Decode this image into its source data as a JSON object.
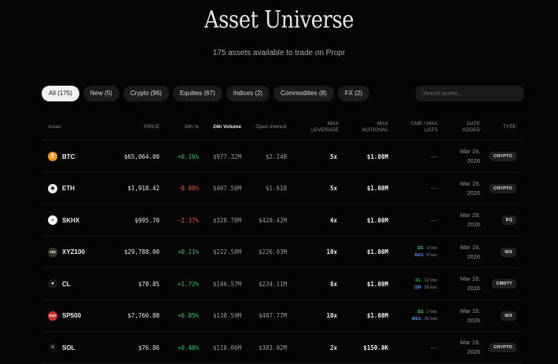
{
  "header": {
    "title": "Asset Universe",
    "subtitle": "175 assets available to trade on Propr"
  },
  "filters": [
    {
      "label": "All (175)",
      "active": true
    },
    {
      "label": "New (5)",
      "active": false
    },
    {
      "label": "Crypto (96)",
      "active": false
    },
    {
      "label": "Equities (67)",
      "active": false
    },
    {
      "label": "Indices (2)",
      "active": false
    },
    {
      "label": "Commodities (8)",
      "active": false
    },
    {
      "label": "FX (2)",
      "active": false
    }
  ],
  "search": {
    "placeholder": "Search assets..."
  },
  "table": {
    "headers": {
      "asset": "Asset",
      "price": "PRICE",
      "change": "24h %",
      "volume": "24h Volume",
      "open_interest": "Open Interest",
      "max_leverage": "MAX LEVERAGE",
      "max_notional": "MAX NOTIONAL",
      "cme_lots": "CME / MAX LOTS",
      "date_added": "DATE ADDED",
      "type": "TYPE"
    },
    "rows": [
      {
        "symbol": "BTC",
        "icon": "bitcoin-icon",
        "icon_glyph": "₿",
        "icon_color": "#f7931a",
        "price": "$65,064.00",
        "change": "+0.16%",
        "dir": "pos",
        "volume": "$977.32M",
        "oi": "$2.24B",
        "leverage": "5x",
        "notional": "$1.00M",
        "lots": [],
        "date_line1": "Mar 19,",
        "date_line2": "2026",
        "type": "CRYPTO"
      },
      {
        "symbol": "ETH",
        "icon": "ethereum-icon",
        "icon_glyph": "◆",
        "icon_color": "#eaeaea",
        "price": "$1,918.42",
        "change": "-0.08%",
        "dir": "neg",
        "volume": "$407.50M",
        "oi": "$1.61B",
        "leverage": "5x",
        "notional": "$1.00M",
        "lots": [],
        "date_line1": "Mar 19,",
        "date_line2": "2026",
        "type": "CRYPTO"
      },
      {
        "symbol": "SKHX",
        "icon": "skhx-icon",
        "icon_glyph": "◒",
        "icon_color": "#f5f5f5",
        "price": "$995.70",
        "change": "-2.37%",
        "dir": "neg",
        "volume": "$328.78M",
        "oi": "$420.42M",
        "leverage": "4x",
        "notional": "$1.00M",
        "lots": [],
        "date_line1": "Mar 19,",
        "date_line2": "2026",
        "type": "EQ"
      },
      {
        "symbol": "XYZ100",
        "icon": "xyz100-icon",
        "icon_glyph": "100",
        "icon_color": "#3a3a2a",
        "price": "$29,788.00",
        "change": "+0.11%",
        "dir": "pos",
        "volume": "$222.58M",
        "oi": "$226.93M",
        "leverage": "10x",
        "notional": "$1.00M",
        "lots": [
          {
            "code": "ES",
            "color": "#34c76a",
            "text": "0 lots"
          },
          {
            "code": "NES",
            "color": "#4a8fe8",
            "text": "8 lots"
          }
        ],
        "date_line1": "Mar 19,",
        "date_line2": "2026",
        "type": "IDX"
      },
      {
        "symbol": "CL",
        "icon": "oil-drop-icon",
        "icon_glyph": "●",
        "icon_color": "#1a1a1a",
        "price": "$78.85",
        "change": "+1.72%",
        "dir": "pos",
        "volume": "$146.57M",
        "oi": "$234.11M",
        "leverage": "8x",
        "notional": "$1.00M",
        "lots": [
          {
            "code": "CL",
            "color": "#34c76a",
            "text": "12 lots"
          },
          {
            "code": "QM",
            "color": "#4a8fe8",
            "text": "35 lots"
          }
        ],
        "date_line1": "Mar 19,",
        "date_line2": "2026",
        "type": "CMDTY"
      },
      {
        "symbol": "SP500",
        "icon": "sp500-icon",
        "icon_glyph": "S&P",
        "icon_color": "#d32f2f",
        "price": "$7,760.80",
        "change": "+0.05%",
        "dir": "pos",
        "volume": "$138.59M",
        "oi": "$487.77M",
        "leverage": "10x",
        "notional": "$1.00M",
        "lots": [
          {
            "code": "ES",
            "color": "#34c76a",
            "text": "2 lots"
          },
          {
            "code": "MES",
            "color": "#4a8fe8",
            "text": "35 lots"
          }
        ],
        "date_line1": "Mar 19,",
        "date_line2": "2026",
        "type": "IDX"
      },
      {
        "symbol": "SOL",
        "icon": "solana-icon",
        "icon_glyph": "≡",
        "icon_color": "#111111",
        "price": "$76.86",
        "change": "+0.48%",
        "dir": "pos",
        "volume": "$118.06M",
        "oi": "$383.02M",
        "leverage": "2x",
        "notional": "$150.0K",
        "lots": [],
        "date_line1": "Mar 19,",
        "date_line2": "2026",
        "type": "CRYPTO"
      }
    ],
    "empty_lots": "—"
  }
}
